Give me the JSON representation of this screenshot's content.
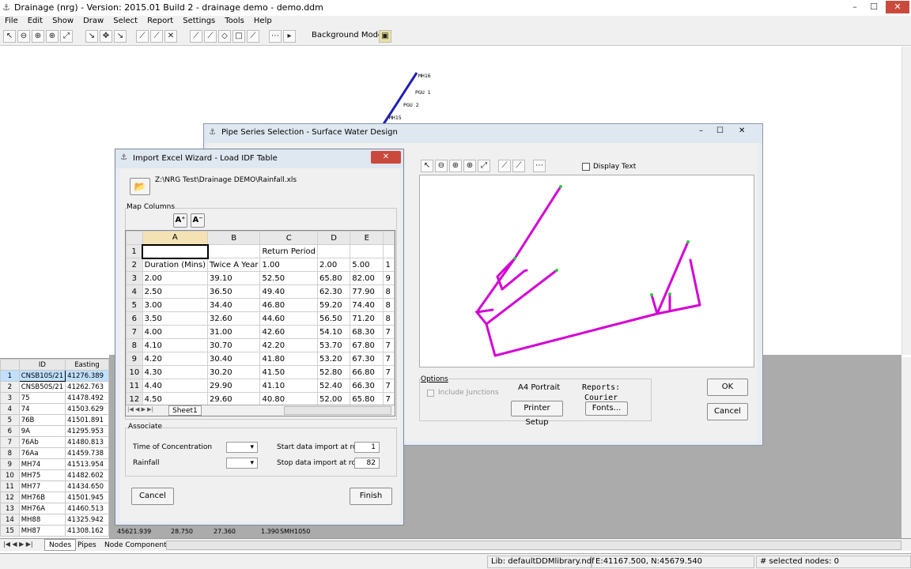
{
  "app": {
    "title": "Drainage (nrg) - Version: 2015.01 Build 2 - drainage demo - demo.ddm",
    "menus": [
      "File",
      "Edit",
      "Show",
      "Draw",
      "Select",
      "Report",
      "Settings",
      "Tools",
      "Help"
    ],
    "background_models_label": "Background Models:",
    "canvas_labels": [
      "MH16",
      "PGU 1",
      "PGU 2",
      "MH15"
    ]
  },
  "nodes_table": {
    "headers": [
      "ID",
      "Easting"
    ],
    "rows": [
      [
        "1",
        "CNSB10S/21",
        "41276.389"
      ],
      [
        "2",
        "CNSB50S/21",
        "41262.763"
      ],
      [
        "3",
        "75",
        "41478.492"
      ],
      [
        "4",
        "74",
        "41503.629"
      ],
      [
        "5",
        "76B",
        "41501.891"
      ],
      [
        "6",
        "9A",
        "41295.953"
      ],
      [
        "7",
        "76Ab",
        "41480.813"
      ],
      [
        "8",
        "76Aa",
        "41459.738"
      ],
      [
        "9",
        "MH74",
        "41513.954"
      ],
      [
        "10",
        "MH75",
        "41482.602"
      ],
      [
        "11",
        "MH77",
        "41434.650"
      ],
      [
        "12",
        "MH76B",
        "41501.945"
      ],
      [
        "13",
        "MH76A",
        "41460.513"
      ],
      [
        "14",
        "MH88",
        "41325.942"
      ],
      [
        "15",
        "MH87",
        "41308.162"
      ]
    ],
    "extra_row": [
      "45621.939",
      "28.750",
      "27.360",
      "1.390",
      "SMH1050"
    ]
  },
  "bottom_tabs": [
    "Nodes",
    "Pipes",
    "Node Components"
  ],
  "status": {
    "lib": "Lib: defaultDDMlibrary.ndf",
    "coords": "E:41167.500, N:45679.540",
    "selected": "# selected nodes: 0"
  },
  "pipe_dialog": {
    "title": "Pipe Series Selection - Surface Water Design",
    "display_text_label": "Display Text",
    "options_label": "Options",
    "include_junctions_label": "Include Junctions",
    "a4_portrait": "A4 Portrait",
    "printer_setup": "Printer Setup",
    "reports_label": "Reports:",
    "courier": "Courier",
    "fonts": "Fonts...",
    "ok": "OK",
    "cancel": "Cancel",
    "plot_color": "#d400d4"
  },
  "wizard": {
    "title": "Import Excel Wizard - Load IDF Table",
    "file_path": "Z:\\NRG Test\\Drainage DEMO\\Rainfall.xls",
    "map_columns_label": "Map Columns",
    "sheet_tab": "Sheet1",
    "associate_label": "Associate",
    "toc_label": "Time of Concentration",
    "rainfall_label": "Rainfall",
    "start_label": "Start data import at row:",
    "start_value": "1",
    "stop_label": "Stop data import at row:",
    "stop_value": "82",
    "cancel": "Cancel",
    "finish": "Finish",
    "grid": {
      "columns": [
        "",
        "A",
        "B",
        "C",
        "D",
        "E",
        ""
      ],
      "rows": [
        [
          "1",
          "",
          "",
          "Return Period",
          "",
          "",
          ""
        ],
        [
          "2",
          "Duration (Mins)",
          "Twice A Year",
          "1.00",
          "2.00",
          "5.00",
          "1"
        ],
        [
          "3",
          "2.00",
          "39.10",
          "52.50",
          "65.80",
          "82.00",
          "9"
        ],
        [
          "4",
          "2.50",
          "36.50",
          "49.40",
          "62.30",
          "77.90",
          "8"
        ],
        [
          "5",
          "3.00",
          "34.40",
          "46.80",
          "59.20",
          "74.40",
          "8"
        ],
        [
          "6",
          "3.50",
          "32.60",
          "44.60",
          "56.50",
          "71.20",
          "8"
        ],
        [
          "7",
          "4.00",
          "31.00",
          "42.60",
          "54.10",
          "68.30",
          "7"
        ],
        [
          "8",
          "4.10",
          "30.70",
          "42.20",
          "53.70",
          "67.80",
          "7"
        ],
        [
          "9",
          "4.20",
          "30.40",
          "41.80",
          "53.20",
          "67.30",
          "7"
        ],
        [
          "10",
          "4.30",
          "30.20",
          "41.50",
          "52.80",
          "66.80",
          "7"
        ],
        [
          "11",
          "4.40",
          "29.90",
          "41.10",
          "52.40",
          "66.30",
          "7"
        ],
        [
          "12",
          "4.50",
          "29.60",
          "40.80",
          "52.00",
          "65.80",
          "7"
        ]
      ]
    }
  }
}
